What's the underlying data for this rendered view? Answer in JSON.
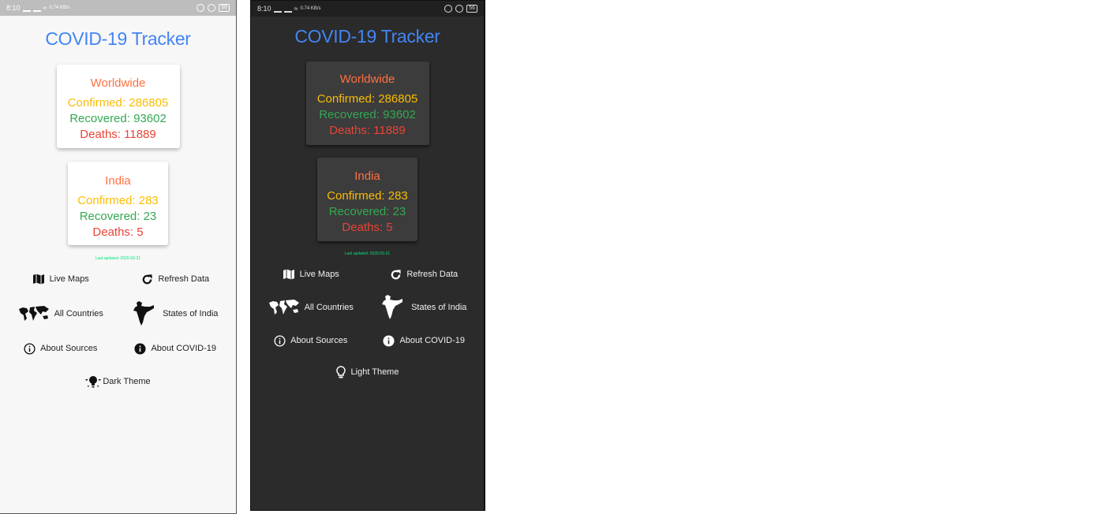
{
  "light": {
    "status": {
      "time": "8:10",
      "net": "0.74 KB/s",
      "battery": "56"
    },
    "title": "COVID-19 Tracker",
    "worldwide": {
      "name": "Worldwide",
      "confirmed": "Confirmed: 286805",
      "recovered": "Recovered: 93602",
      "deaths": "Deaths: 11889"
    },
    "india": {
      "name": "India",
      "confirmed": "Confirmed: 283",
      "recovered": "Recovered: 23",
      "deaths": "Deaths: 5"
    },
    "updated": "Last updated: 2020-03-21",
    "buttons": {
      "live_maps": "Live Maps",
      "refresh": "Refresh Data",
      "all_countries": "All Countries",
      "states": "States of India",
      "about_sources": "About Sources",
      "about_covid": "About COVID-19",
      "theme": "Dark Theme"
    }
  },
  "dark": {
    "status": {
      "time": "8:10",
      "net": "0.74 KB/s",
      "battery": "56"
    },
    "title": "COVID-19 Tracker",
    "worldwide": {
      "name": "Worldwide",
      "confirmed": "Confirmed: 286805",
      "recovered": "Recovered: 93602",
      "deaths": "Deaths: 11889"
    },
    "india": {
      "name": "India",
      "confirmed": "Confirmed: 283",
      "recovered": "Recovered: 23",
      "deaths": "Deaths: 5"
    },
    "updated": "Last updated: 2020-03-21",
    "buttons": {
      "live_maps": "Live Maps",
      "refresh": "Refresh Data",
      "all_countries": "All Countries",
      "states": "States of India",
      "about_sources": "About Sources",
      "about_covid": "About COVID-19",
      "theme": "Light Theme"
    }
  },
  "icons": {
    "live_maps": "map-icon",
    "refresh": "refresh-icon",
    "all_countries": "world-map-icon",
    "states": "india-map-icon",
    "about_sources": "info-outline-icon",
    "about_covid": "info-filled-icon",
    "dark_theme": "lightbulb-filled-icon",
    "light_theme": "lightbulb-outline-icon"
  },
  "colors": {
    "title": "#4285f4",
    "card_title": "#ff7043",
    "confirmed": "#fbbc04",
    "recovered": "#34a853",
    "deaths": "#ea4335",
    "updated": "#00e676"
  }
}
